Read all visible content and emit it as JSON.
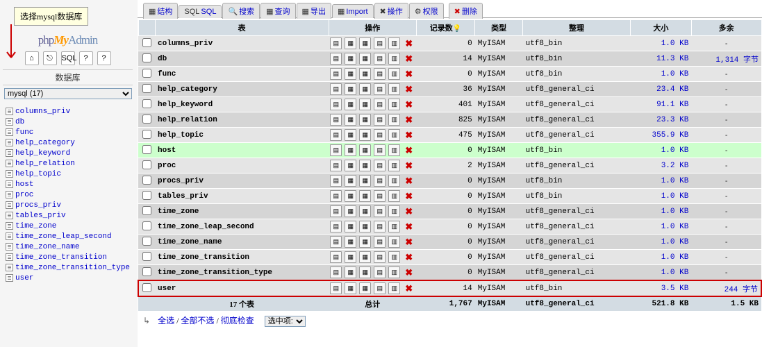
{
  "callout": "选择mysql数据库",
  "logo": {
    "php": "php",
    "my": "My",
    "admin": "Admin"
  },
  "nav_icons": [
    "⌂",
    "⎋",
    "SQL",
    "?",
    "?"
  ],
  "db_label": "数据库",
  "db_selected": "mysql (17)",
  "sidebar_tables": [
    "columns_priv",
    "db",
    "func",
    "help_category",
    "help_keyword",
    "help_relation",
    "help_topic",
    "host",
    "proc",
    "procs_priv",
    "tables_priv",
    "time_zone",
    "time_zone_leap_second",
    "time_zone_name",
    "time_zone_transition",
    "time_zone_transition_type",
    "user"
  ],
  "tabs": [
    {
      "icon": "▦",
      "label": "结构"
    },
    {
      "icon": "SQL",
      "label": "SQL"
    },
    {
      "icon": "🔍",
      "label": "搜索"
    },
    {
      "icon": "▦",
      "label": "查询"
    },
    {
      "icon": "▦",
      "label": "导出"
    },
    {
      "icon": "▦",
      "label": "Import"
    },
    {
      "icon": "✖",
      "label": "操作"
    },
    {
      "icon": "⚙",
      "label": "权限"
    },
    {
      "icon": "✖",
      "label": "删除",
      "danger": true
    }
  ],
  "columns": {
    "table": "表",
    "ops": "操作",
    "records": "记录数",
    "type": "类型",
    "collation": "整理",
    "size": "大小",
    "extra": "多余"
  },
  "rows": [
    {
      "name": "columns_priv",
      "records": 0,
      "type": "MyISAM",
      "coll": "utf8_bin",
      "size": "1.0 KB",
      "extra": "-",
      "cls": "odd"
    },
    {
      "name": "db",
      "records": 14,
      "type": "MyISAM",
      "coll": "utf8_bin",
      "size": "11.3 KB",
      "extra": "1,314 字节",
      "cls": "even"
    },
    {
      "name": "func",
      "records": 0,
      "type": "MyISAM",
      "coll": "utf8_bin",
      "size": "1.0 KB",
      "extra": "-",
      "cls": "odd"
    },
    {
      "name": "help_category",
      "records": 36,
      "type": "MyISAM",
      "coll": "utf8_general_ci",
      "size": "23.4 KB",
      "extra": "-",
      "cls": "even"
    },
    {
      "name": "help_keyword",
      "records": 401,
      "type": "MyISAM",
      "coll": "utf8_general_ci",
      "size": "91.1 KB",
      "extra": "-",
      "cls": "odd"
    },
    {
      "name": "help_relation",
      "records": 825,
      "type": "MyISAM",
      "coll": "utf8_general_ci",
      "size": "23.3 KB",
      "extra": "-",
      "cls": "even"
    },
    {
      "name": "help_topic",
      "records": 475,
      "type": "MyISAM",
      "coll": "utf8_general_ci",
      "size": "355.9 KB",
      "extra": "-",
      "cls": "odd"
    },
    {
      "name": "host",
      "records": 0,
      "type": "MyISAM",
      "coll": "utf8_bin",
      "size": "1.0 KB",
      "extra": "-",
      "cls": "hl"
    },
    {
      "name": "proc",
      "records": 2,
      "type": "MyISAM",
      "coll": "utf8_general_ci",
      "size": "3.2 KB",
      "extra": "-",
      "cls": "odd"
    },
    {
      "name": "procs_priv",
      "records": 0,
      "type": "MyISAM",
      "coll": "utf8_bin",
      "size": "1.0 KB",
      "extra": "-",
      "cls": "even"
    },
    {
      "name": "tables_priv",
      "records": 0,
      "type": "MyISAM",
      "coll": "utf8_bin",
      "size": "1.0 KB",
      "extra": "-",
      "cls": "odd"
    },
    {
      "name": "time_zone",
      "records": 0,
      "type": "MyISAM",
      "coll": "utf8_general_ci",
      "size": "1.0 KB",
      "extra": "-",
      "cls": "even"
    },
    {
      "name": "time_zone_leap_second",
      "records": 0,
      "type": "MyISAM",
      "coll": "utf8_general_ci",
      "size": "1.0 KB",
      "extra": "-",
      "cls": "odd"
    },
    {
      "name": "time_zone_name",
      "records": 0,
      "type": "MyISAM",
      "coll": "utf8_general_ci",
      "size": "1.0 KB",
      "extra": "-",
      "cls": "even"
    },
    {
      "name": "time_zone_transition",
      "records": 0,
      "type": "MyISAM",
      "coll": "utf8_general_ci",
      "size": "1.0 KB",
      "extra": "-",
      "cls": "odd"
    },
    {
      "name": "time_zone_transition_type",
      "records": 0,
      "type": "MyISAM",
      "coll": "utf8_general_ci",
      "size": "1.0 KB",
      "extra": "-",
      "cls": "even"
    },
    {
      "name": "user",
      "records": 14,
      "type": "MyISAM",
      "coll": "utf8_bin",
      "size": "3.5 KB",
      "extra": "244 字节",
      "cls": "user"
    }
  ],
  "op_icons": [
    "▤",
    "▦",
    "▦",
    "▤",
    "▥",
    "✖"
  ],
  "totals": {
    "label": "17 个表",
    "sum": "总计",
    "records": "1,767",
    "type": "MyISAM",
    "coll": "utf8_general_ci",
    "size": "521.8 KB",
    "extra": "1.5 KB"
  },
  "footer": {
    "select_all": "全选",
    "select_none": "全部不选",
    "check": "彻底检查",
    "with_selected": "选中项:",
    "sep": " / "
  }
}
